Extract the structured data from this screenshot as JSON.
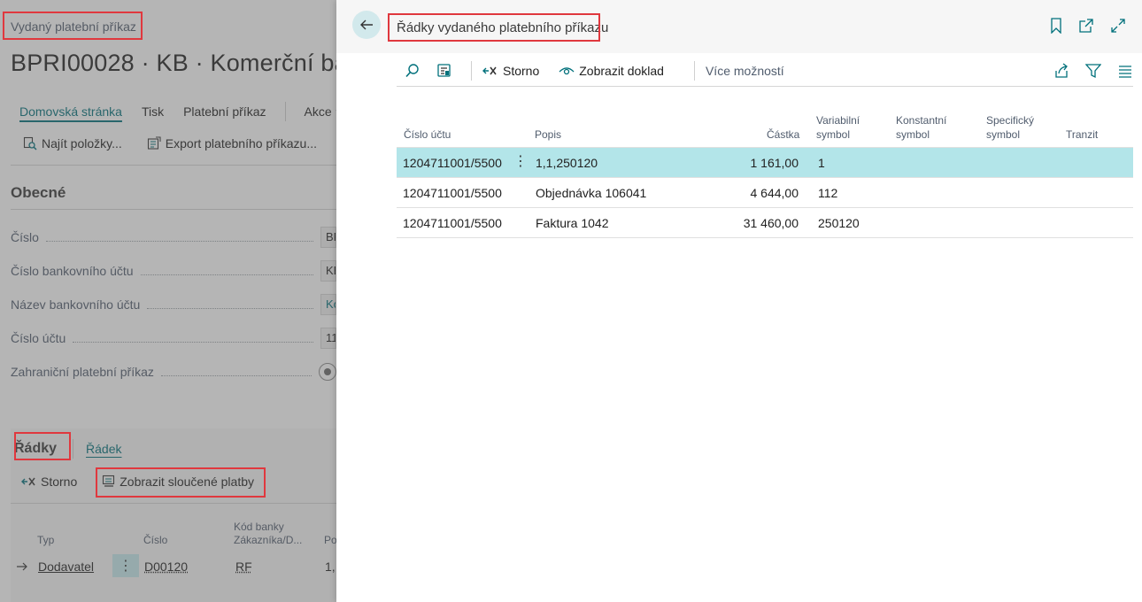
{
  "background": {
    "caption": "Vydaný platební příkaz",
    "title": "BPRI00028 · KB · Komerční ba",
    "menu": {
      "home": "Domovská stránka",
      "print": "Tisk",
      "payment_order": "Platební příkaz",
      "actions": "Akce"
    },
    "actions": {
      "find_entries": "Najít položky...",
      "export": "Export platebního příkazu..."
    },
    "section": "Obecné",
    "fields": [
      {
        "label": "Číslo",
        "value": "BF"
      },
      {
        "label": "Číslo bankovního účtu",
        "value": "KE"
      },
      {
        "label": "Název bankovního účtu",
        "value": "Ko"
      },
      {
        "label": "Číslo účtu",
        "value": "11"
      },
      {
        "label": "Zahraniční platební příkaz",
        "value": ""
      }
    ],
    "lines": {
      "tab_lines": "Řádky",
      "tab_line": "Řádek",
      "cancel": "Storno",
      "show_merged": "Zobrazit sloučené platby",
      "headers": {
        "type": "Typ",
        "number": "Číslo",
        "bank_code_1": "Kód banky",
        "bank_code_2": "Zákazníka/D...",
        "po": "Po"
      },
      "row": {
        "type": "Dodavatel",
        "number": "D00120",
        "bank": "RF",
        "po": "1,"
      }
    }
  },
  "dialog": {
    "title": "Řádky vydaného platebního příkazu",
    "toolbar": {
      "cancel": "Storno",
      "show_document": "Zobrazit doklad",
      "more": "Více možností"
    },
    "columns": {
      "account": "Číslo účtu",
      "description": "Popis",
      "amount": "Částka",
      "variable_1": "Variabilní",
      "variable_2": "symbol",
      "constant_1": "Konstantní",
      "constant_2": "symbol",
      "specific_1": "Specifický",
      "specific_2": "symbol",
      "transit": "Tranzit"
    },
    "rows": [
      {
        "account": "1204711001/5500",
        "description": "1,1,250120",
        "amount": "1 161,00",
        "variable": "1"
      },
      {
        "account": "1204711001/5500",
        "description": "Objednávka 106041",
        "amount": "4 644,00",
        "variable": "112"
      },
      {
        "account": "1204711001/5500",
        "description": "Faktura 1042",
        "amount": "31 460,00",
        "variable": "250120"
      }
    ]
  },
  "colors": {
    "accent": "#00707b",
    "selected_row": "#b3e5e9",
    "annotation": "#e0383e"
  }
}
